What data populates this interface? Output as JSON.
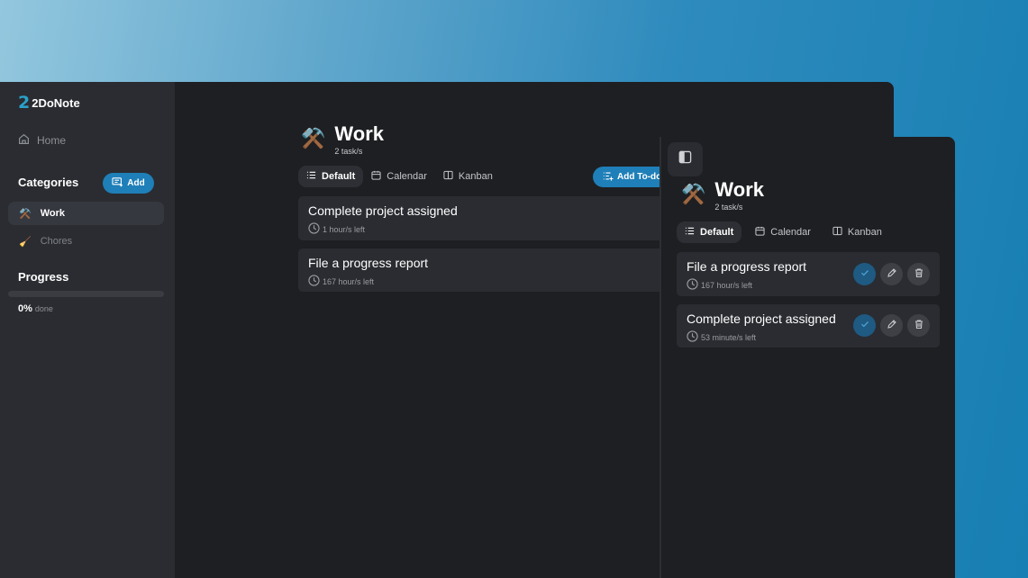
{
  "app": {
    "logo_mark": "2",
    "name": "2DoNote"
  },
  "sidebar": {
    "home_label": "Home",
    "categories_title": "Categories",
    "add_label": "Add",
    "categories": [
      {
        "emoji": "⚒️",
        "label": "Work",
        "active": true
      },
      {
        "emoji": "🧹",
        "label": "Chores",
        "active": false
      }
    ],
    "progress_title": "Progress",
    "progress_percent": "0%",
    "progress_suffix": "done",
    "progress_value": 0
  },
  "main": {
    "category_emoji": "⚒️",
    "category_title": "Work",
    "task_count": "2 task/s",
    "tabs": [
      {
        "label": "Default",
        "icon": "list-icon"
      },
      {
        "label": "Calendar",
        "icon": "calendar-icon"
      },
      {
        "label": "Kanban",
        "icon": "columns-icon"
      }
    ],
    "add_todo_label": "Add To-do",
    "tasks": [
      {
        "name": "Complete project assigned",
        "time": "1 hour/s left"
      },
      {
        "name": "File a progress report",
        "time": "167 hour/s left"
      }
    ]
  },
  "side": {
    "category_emoji": "⚒️",
    "category_title": "Work",
    "task_count": "2 task/s",
    "tabs": [
      {
        "label": "Default",
        "icon": "list-icon"
      },
      {
        "label": "Calendar",
        "icon": "calendar-icon"
      },
      {
        "label": "Kanban",
        "icon": "columns-icon"
      }
    ],
    "tasks": [
      {
        "name": "File a progress report",
        "time": "167 hour/s left"
      },
      {
        "name": "Complete project assigned",
        "time": "53 minute/s left"
      }
    ]
  },
  "colors": {
    "accent": "#1f7fb8",
    "window_bg": "#1e1f22",
    "sidebar_bg": "#2a2c31",
    "logo": "#2aa1c9"
  }
}
